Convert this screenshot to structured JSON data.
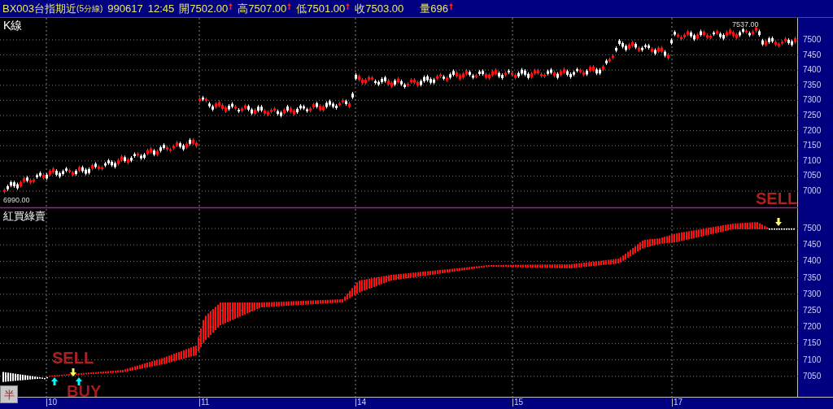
{
  "title_bar": {
    "symbol": "BX003台指期近",
    "period": "(5分線)",
    "date": "990617",
    "time": "12:45",
    "quotes": [
      {
        "label": "開",
        "value": "7502.00",
        "up": true
      },
      {
        "label": "高",
        "value": "7507.00",
        "up": true
      },
      {
        "label": "低",
        "value": "7501.00",
        "up": true
      },
      {
        "label": "收",
        "value": "7503.00",
        "up": false
      },
      {
        "label": "量",
        "value": "696",
        "up": true
      }
    ]
  },
  "price_panel": {
    "title": "K線",
    "high_label": "7537.00",
    "low_label": "6990.00",
    "y_axis": [
      "7500",
      "7450",
      "7400",
      "7350",
      "7300",
      "7250",
      "7200",
      "7150",
      "7100",
      "7050",
      "7000"
    ]
  },
  "signal_panel": {
    "title": "紅買綠賣",
    "signals": [
      {
        "kind": "sell",
        "text": "SELL"
      },
      {
        "kind": "buy",
        "text": "BUY"
      },
      {
        "kind": "sell",
        "text": "SELL"
      }
    ],
    "y_axis": [
      "7500",
      "7450",
      "7400",
      "7350",
      "7300",
      "7250",
      "7200",
      "7150",
      "7100",
      "7050"
    ]
  },
  "x_axis": [
    "10",
    "11",
    "14",
    "15",
    "17"
  ],
  "corner_button": {
    "text": "半"
  }
}
